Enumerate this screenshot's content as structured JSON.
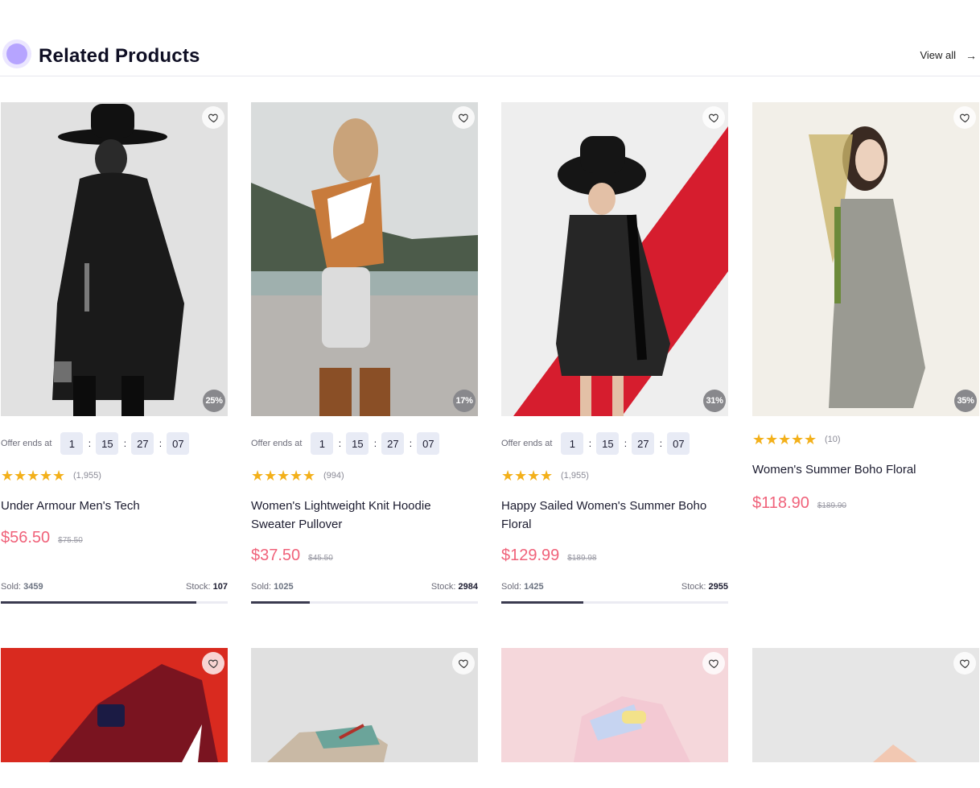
{
  "section": {
    "title": "Related Products",
    "view_all": "View all"
  },
  "icons": {
    "header": "dot-icon",
    "view_all": "arrow-right-icon",
    "wishlist": "heart-icon",
    "rating": "star-icon"
  },
  "colors": {
    "accent": "#b6a4ff",
    "price": "#f0627a",
    "star": "#f3b01a",
    "bar": "#3a3a4f"
  },
  "offer_label": "Offer ends at",
  "timer": {
    "days": "1",
    "hours": "15",
    "minutes": "27",
    "seconds": "07"
  },
  "products": [
    {
      "discount": "25%",
      "has_timer": true,
      "stars": 5,
      "reviews": "(1,955)",
      "name": "Under Armour Men's Tech",
      "price": "$56.50",
      "old_price": "$75.50",
      "sold_label": "Sold:",
      "sold": "3459",
      "stock_label": "Stock:",
      "stock": "107",
      "progress": 0.86
    },
    {
      "discount": "17%",
      "has_timer": true,
      "stars": 5,
      "reviews": "(994)",
      "name": "Women's Lightweight Knit Hoodie Sweater Pullover",
      "price": "$37.50",
      "old_price": "$45.50",
      "sold_label": "Sold:",
      "sold": "1025",
      "stock_label": "Stock:",
      "stock": "2984",
      "progress": 0.26
    },
    {
      "discount": "31%",
      "has_timer": true,
      "stars": 4,
      "reviews": "(1,955)",
      "name": "Happy Sailed Women's Summer Boho Floral",
      "price": "$129.99",
      "old_price": "$189.98",
      "sold_label": "Sold:",
      "sold": "1425",
      "stock_label": "Stock:",
      "stock": "2955",
      "progress": 0.36
    },
    {
      "discount": "35%",
      "has_timer": false,
      "stars": 5,
      "reviews": "(10)",
      "name": "Women's Summer Boho Floral",
      "price": "$118.90",
      "old_price": "$189.90"
    }
  ]
}
